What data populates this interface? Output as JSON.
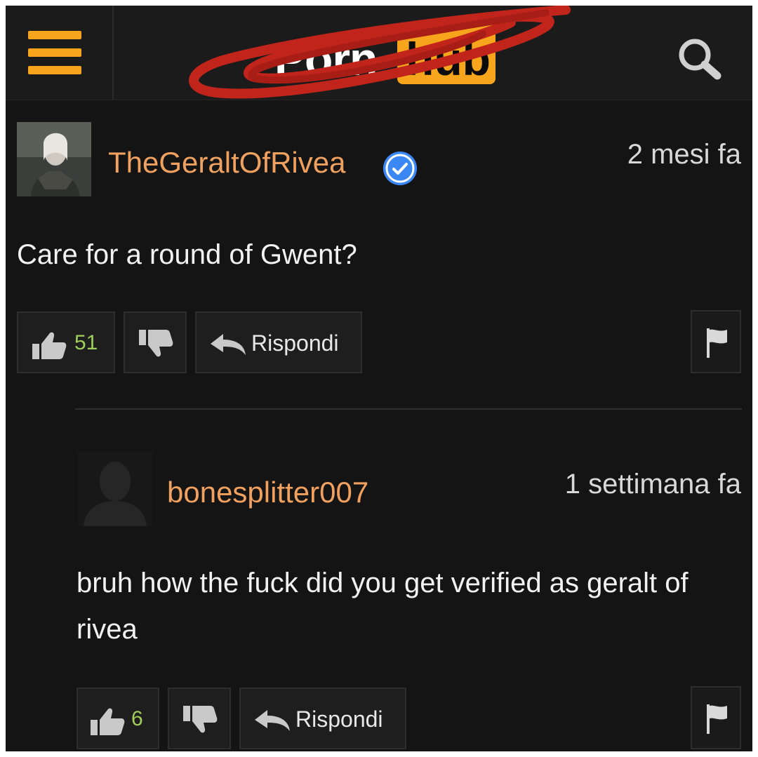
{
  "header": {
    "logo_text": "Porn",
    "logo_badge": "hub",
    "menu_icon": "hamburger-menu-icon",
    "search_icon": "search-icon",
    "accent": "#f7a51c"
  },
  "comments": [
    {
      "username": "TheGeraltOfRivea",
      "verified": true,
      "timestamp": "2 mesi fa",
      "text": "Care for a round of Gwent?",
      "likes": "51",
      "reply_label": "Rispondi"
    },
    {
      "username": "bonesplitter007",
      "verified": false,
      "timestamp": "1 settimana fa",
      "text": "bruh how the fuck did you get verified as geralt of rivea",
      "likes": "6",
      "reply_label": "Rispondi"
    }
  ],
  "colors": {
    "background": "#141414",
    "username": "#f0a15f",
    "like_count": "#9fcf5a",
    "verified_badge": "#3b88f5"
  }
}
